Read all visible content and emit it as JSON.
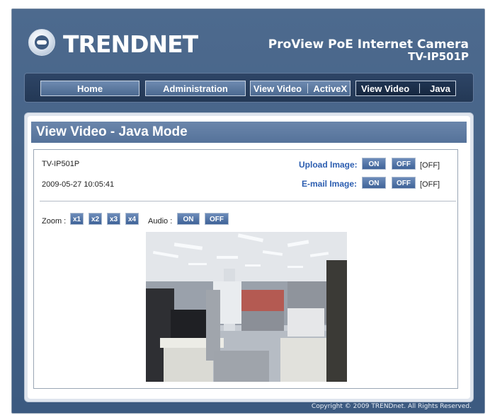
{
  "header": {
    "logo_text": "TRENDNET",
    "product_line": "ProView PoE Internet Camera",
    "model": "TV-IP501P"
  },
  "nav": {
    "home": "Home",
    "administration": "Administration",
    "view_video_activex_left": "View Video",
    "view_video_activex_right": "ActiveX",
    "view_video_java_left": "View Video",
    "view_video_java_right": "Java"
  },
  "page": {
    "title": "View Video - Java Mode"
  },
  "camera_info": {
    "name": "TV-IP501P",
    "datetime": "2009-05-27 10:05:41"
  },
  "upload_image": {
    "label": "Upload Image:",
    "on": "ON",
    "off": "OFF",
    "state": "[OFF]"
  },
  "email_image": {
    "label": "E-mail Image:",
    "on": "ON",
    "off": "OFF",
    "state": "[OFF]"
  },
  "zoom": {
    "label": "Zoom :",
    "options": [
      "x1",
      "x2",
      "x3",
      "x4"
    ]
  },
  "audio": {
    "label": "Audio :",
    "on": "ON",
    "off": "OFF"
  },
  "footer": {
    "copyright": "Copyright © 2009 TRENDnet. All Rights Reserved."
  },
  "colors": {
    "frame_blue": "#4d6a8e",
    "title_bar": "#6b86ab",
    "label_blue": "#2b5db0"
  }
}
